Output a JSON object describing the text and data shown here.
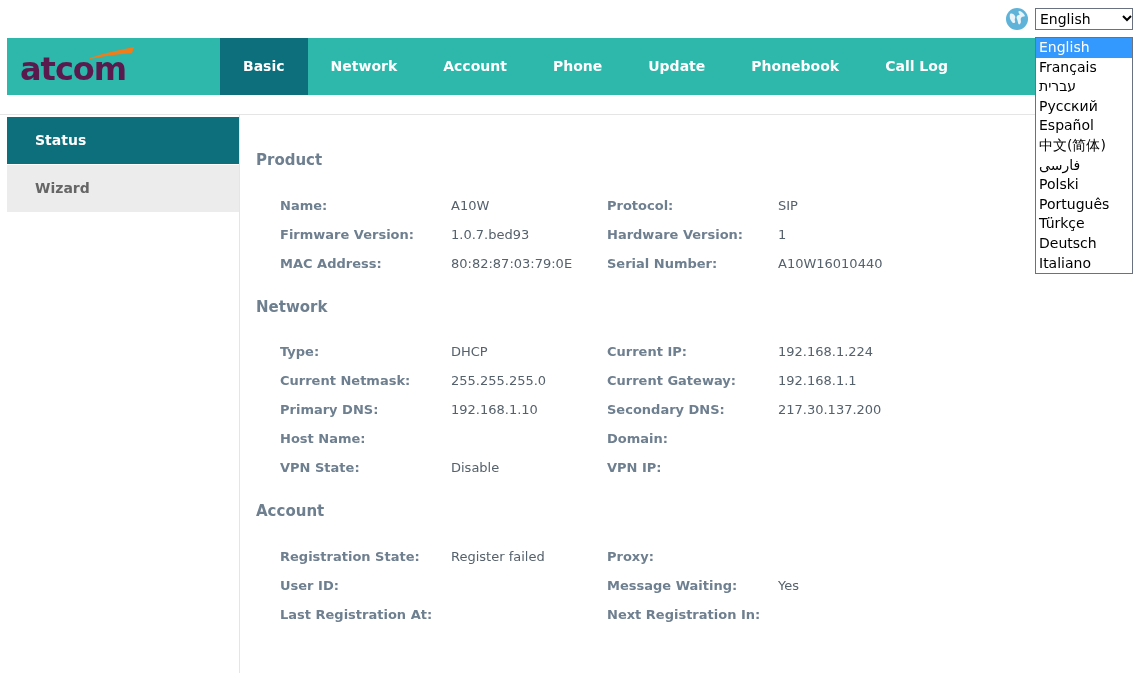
{
  "language_selector": {
    "value": "English",
    "expanded": true,
    "options": [
      {
        "label": "English",
        "selected": true
      },
      {
        "label": "Français",
        "selected": false
      },
      {
        "label": "עברית",
        "selected": false
      },
      {
        "label": "Русский",
        "selected": false
      },
      {
        "label": "Español",
        "selected": false
      },
      {
        "label": "中文(简体)",
        "selected": false
      },
      {
        "label": "فارسی",
        "selected": false
      },
      {
        "label": "Polski",
        "selected": false
      },
      {
        "label": "Português",
        "selected": false
      },
      {
        "label": "Türkçe",
        "selected": false
      },
      {
        "label": "Deutsch",
        "selected": false
      },
      {
        "label": "Italiano",
        "selected": false
      }
    ]
  },
  "logo": "atcom",
  "nav_tabs": [
    {
      "label": "Basic",
      "selected": true
    },
    {
      "label": "Network",
      "selected": false
    },
    {
      "label": "Account",
      "selected": false
    },
    {
      "label": "Phone",
      "selected": false
    },
    {
      "label": "Update",
      "selected": false
    },
    {
      "label": "Phonebook",
      "selected": false
    },
    {
      "label": "Call Log",
      "selected": false
    }
  ],
  "sidebar": {
    "items": [
      {
        "label": "Status",
        "selected": true
      },
      {
        "label": "Wizard",
        "selected": false
      }
    ]
  },
  "sections": [
    {
      "title": "Product",
      "rows": [
        [
          {
            "label": "Name:",
            "value": "A10W"
          },
          {
            "label": "Protocol:",
            "value": "SIP"
          }
        ],
        [
          {
            "label": "Firmware Version:",
            "value": "1.0.7.bed93"
          },
          {
            "label": "Hardware Version:",
            "value": "1"
          }
        ],
        [
          {
            "label": "MAC Address:",
            "value": "80:82:87:03:79:0E"
          },
          {
            "label": "Serial Number:",
            "value": "A10W16010440"
          }
        ]
      ]
    },
    {
      "title": "Network",
      "rows": [
        [
          {
            "label": "Type:",
            "value": "DHCP"
          },
          {
            "label": "Current IP:",
            "value": "192.168.1.224"
          }
        ],
        [
          {
            "label": "Current Netmask:",
            "value": "255.255.255.0"
          },
          {
            "label": "Current Gateway:",
            "value": "192.168.1.1"
          }
        ],
        [
          {
            "label": "Primary DNS:",
            "value": "192.168.1.10"
          },
          {
            "label": "Secondary DNS:",
            "value": "217.30.137.200"
          }
        ],
        [
          {
            "label": "Host Name:"
          },
          {
            "label": "Domain:"
          }
        ],
        [
          {
            "label": "VPN State:",
            "value": "Disable"
          },
          {
            "label": "VPN IP:"
          }
        ]
      ]
    },
    {
      "title": "Account",
      "rows": [
        [
          {
            "label": "Registration State:",
            "value": "Register failed"
          },
          {
            "label": "Proxy:"
          }
        ],
        [
          {
            "label": "User ID:"
          },
          {
            "label": "Message Waiting:",
            "value": "Yes"
          }
        ],
        [
          {
            "label": "Last Registration At:"
          },
          {
            "label": "Next Registration In:"
          }
        ]
      ]
    }
  ]
}
